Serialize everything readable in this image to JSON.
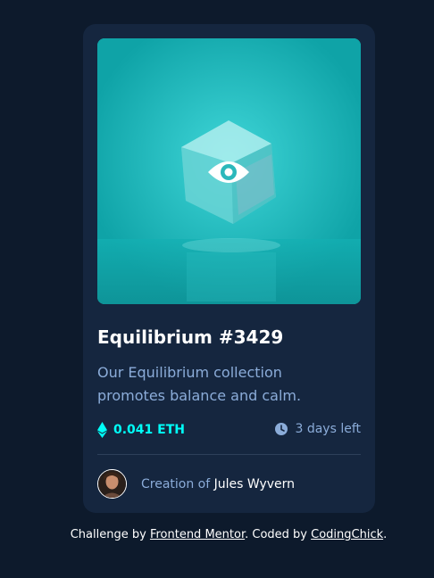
{
  "card": {
    "title": "Equilibrium #3429",
    "description": "Our Equilibrium collection promotes balance and calm.",
    "price": "0.041 ETH",
    "time_left": "3 days left",
    "creator_prefix": "Creation of",
    "creator_name": "Jules Wyvern"
  },
  "attribution": {
    "prefix": "Challenge by",
    "link1": "Frontend Mentor",
    "middle": ". Coded by",
    "link2": "CodingChick",
    "suffix": "."
  },
  "colors": {
    "page_bg": "#0d1a2c",
    "card_bg": "#15263f",
    "accent_cyan": "#00fff8",
    "soft_blue": "#8bacd9",
    "white": "#ffffff"
  },
  "icons": [
    "view-eye-icon",
    "ethereum-icon",
    "clock-icon"
  ]
}
